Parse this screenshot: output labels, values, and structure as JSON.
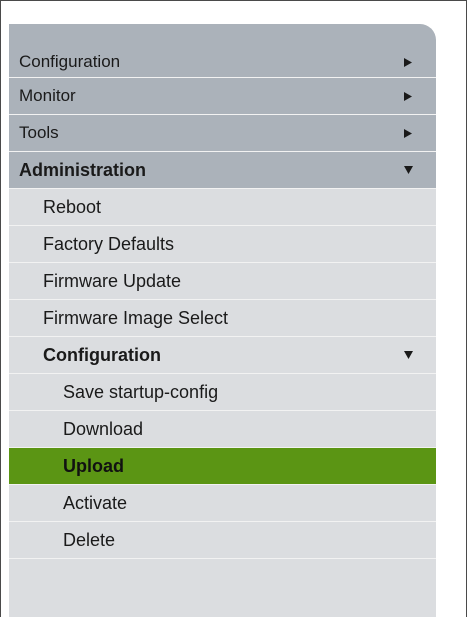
{
  "menu": {
    "top_items": [
      {
        "label": "Configuration",
        "icon": "triangle-right-icon"
      },
      {
        "label": "Monitor",
        "icon": "triangle-right-icon"
      },
      {
        "label": "Tools",
        "icon": "triangle-right-icon"
      },
      {
        "label": "Administration",
        "icon": "triangle-down-icon"
      }
    ],
    "admin_items": [
      {
        "label": "Reboot"
      },
      {
        "label": "Factory Defaults"
      },
      {
        "label": "Firmware Update"
      },
      {
        "label": "Firmware Image Select"
      },
      {
        "label": "Configuration",
        "icon": "triangle-down-icon"
      }
    ],
    "config_items": [
      {
        "label": "Save startup-config"
      },
      {
        "label": "Download"
      },
      {
        "label": "Upload",
        "active": true
      },
      {
        "label": "Activate"
      },
      {
        "label": "Delete"
      }
    ],
    "colors": {
      "top_bg": "#abb2ba",
      "sub_bg": "#dbdde0",
      "active_bg": "#5b9514"
    }
  }
}
